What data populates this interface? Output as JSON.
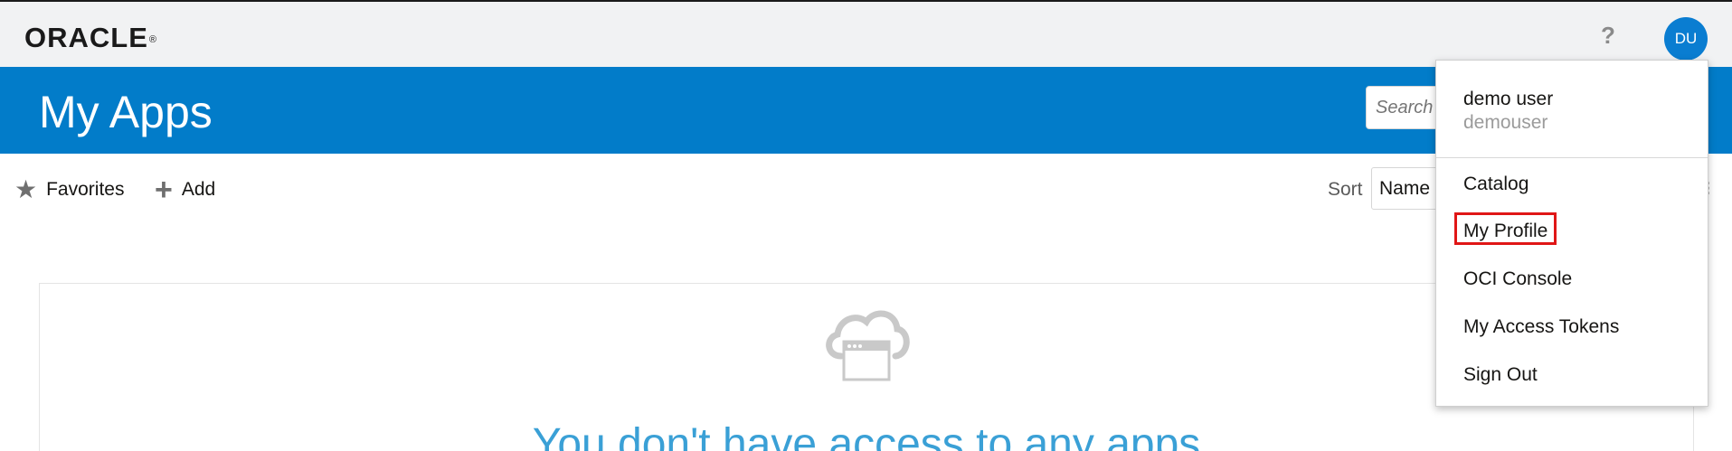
{
  "header": {
    "logo_text": "ORACLE",
    "logo_mark": "®",
    "help_label": "?",
    "avatar_initials": "DU",
    "avatar_color": "#0a7dd1"
  },
  "title_band": {
    "title": "My Apps",
    "background": "#027cc9",
    "search_placeholder": "Search"
  },
  "toolbar": {
    "favorites_label": "Favorites",
    "favorites_icon": "star-icon",
    "add_label": "Add",
    "add_icon": "plus-icon",
    "sort_label": "Sort",
    "sort_value": "Name",
    "overflow_mark": "⁝"
  },
  "empty_state": {
    "icon": "cloud-app-icon",
    "message": "You don't have access to any apps"
  },
  "user_menu": {
    "display_name": "demo user",
    "username": "demouser",
    "items": [
      {
        "label": "Catalog"
      },
      {
        "label": "My Profile",
        "highlighted": true
      },
      {
        "label": "OCI Console"
      },
      {
        "label": "My Access Tokens"
      },
      {
        "label": "Sign Out"
      }
    ],
    "highlight_color": "#e01616"
  }
}
